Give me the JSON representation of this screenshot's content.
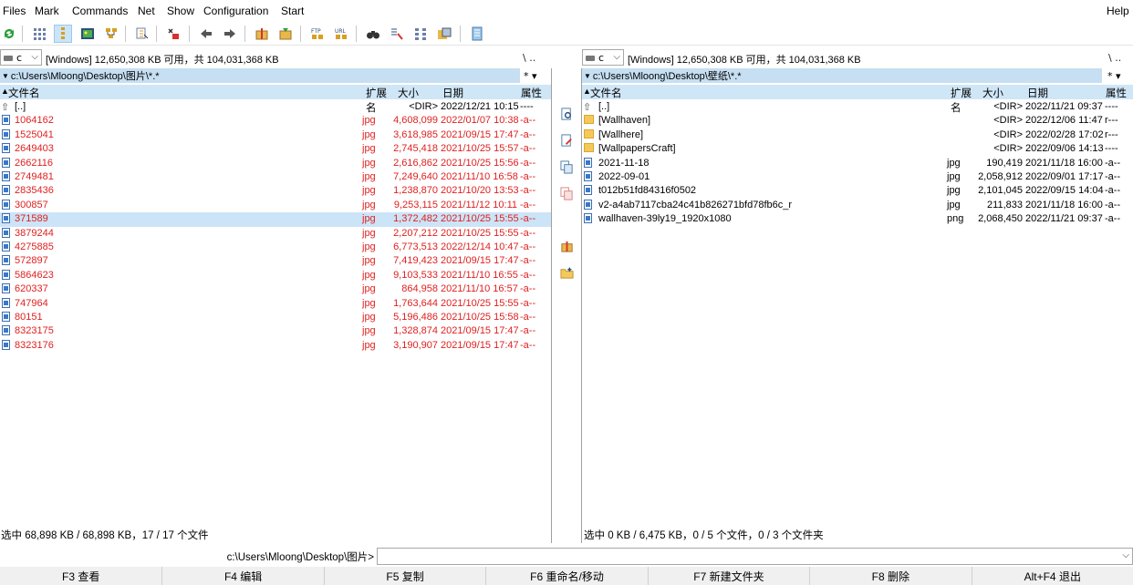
{
  "menu": {
    "files": "Files",
    "mark": "Mark",
    "commands": "Commands",
    "net": "Net",
    "show": "Show",
    "configuration": "Configuration",
    "start": "Start",
    "help": "Help"
  },
  "toolbar": {
    "icons": [
      "refresh-icon",
      "brief-view-icon",
      "full-view-icon",
      "thumbnail-icon",
      "tree-icon",
      "invert-selection-icon",
      "unpack-icon",
      "back-icon",
      "forward-icon",
      "pack-icon",
      "unpack-files-icon",
      "ftp-icon",
      "url-icon",
      "search-icon",
      "multi-rename-icon",
      "sync-dirs-icon",
      "compare-icon",
      "notepad-icon"
    ]
  },
  "left": {
    "drive": "c",
    "drive_info": "[Windows]  12,650,308 KB 可用，共 104,031,368 KB",
    "root_btns": "\\   ..",
    "path": "c:\\Users\\Mloong\\Desktop\\图片\\*.*",
    "path_tools": "*  ▾",
    "columns": {
      "name": "文件名",
      "ext": "扩展名",
      "size": "大小",
      "date": "日期",
      "attr": "属性"
    },
    "up": {
      "name": "[..]",
      "size": "<DIR>",
      "date": "2022/12/21 10:15",
      "attr": "----"
    },
    "files": [
      {
        "name": "1064162",
        "ext": "jpg",
        "size": "4,608,099",
        "date": "2022/01/07 10:38",
        "attr": "-a--"
      },
      {
        "name": "1525041",
        "ext": "jpg",
        "size": "3,618,985",
        "date": "2021/09/15 17:47",
        "attr": "-a--"
      },
      {
        "name": "2649403",
        "ext": "jpg",
        "size": "2,745,418",
        "date": "2021/10/25 15:57",
        "attr": "-a--"
      },
      {
        "name": "2662116",
        "ext": "jpg",
        "size": "2,616,862",
        "date": "2021/10/25 15:56",
        "attr": "-a--"
      },
      {
        "name": "2749481",
        "ext": "jpg",
        "size": "7,249,640",
        "date": "2021/11/10 16:58",
        "attr": "-a--"
      },
      {
        "name": "2835436",
        "ext": "jpg",
        "size": "1,238,870",
        "date": "2021/10/20 13:53",
        "attr": "-a--"
      },
      {
        "name": "300857",
        "ext": "jpg",
        "size": "9,253,115",
        "date": "2021/11/12 10:11",
        "attr": "-a--"
      },
      {
        "name": "371589",
        "ext": "jpg",
        "size": "1,372,482",
        "date": "2021/10/25 15:55",
        "attr": "-a--"
      },
      {
        "name": "3879244",
        "ext": "jpg",
        "size": "2,207,212",
        "date": "2021/10/25 15:55",
        "attr": "-a--"
      },
      {
        "name": "4275885",
        "ext": "jpg",
        "size": "6,773,513",
        "date": "2022/12/14 10:47",
        "attr": "-a--"
      },
      {
        "name": "572897",
        "ext": "jpg",
        "size": "7,419,423",
        "date": "2021/09/15 17:47",
        "attr": "-a--"
      },
      {
        "name": "5864623",
        "ext": "jpg",
        "size": "9,103,533",
        "date": "2021/11/10 16:55",
        "attr": "-a--"
      },
      {
        "name": "620337",
        "ext": "jpg",
        "size": "864,958",
        "date": "2021/11/10 16:57",
        "attr": "-a--"
      },
      {
        "name": "747964",
        "ext": "jpg",
        "size": "1,763,644",
        "date": "2021/10/25 15:55",
        "attr": "-a--"
      },
      {
        "name": "80151",
        "ext": "jpg",
        "size": "5,196,486",
        "date": "2021/10/25 15:58",
        "attr": "-a--"
      },
      {
        "name": "8323175",
        "ext": "jpg",
        "size": "1,328,874",
        "date": "2021/09/15 17:47",
        "attr": "-a--"
      },
      {
        "name": "8323176",
        "ext": "jpg",
        "size": "3,190,907",
        "date": "2021/09/15 17:47",
        "attr": "-a--"
      }
    ],
    "status": "选中 68,898 KB / 68,898 KB，17 / 17 个文件"
  },
  "right": {
    "drive": "c",
    "drive_info": "[Windows]  12,650,308 KB 可用，共 104,031,368 KB",
    "root_btns": "\\   ..",
    "path": "c:\\Users\\Mloong\\Desktop\\壁纸\\*.*",
    "path_tools": "*  ▾",
    "columns": {
      "name": "文件名",
      "ext": "扩展名",
      "size": "大小",
      "date": "日期",
      "attr": "属性"
    },
    "up": {
      "name": "[..]",
      "size": "<DIR>",
      "date": "2022/11/21 09:37",
      "attr": "----"
    },
    "dirs": [
      {
        "name": "[Wallhaven]",
        "size": "<DIR>",
        "date": "2022/12/06 11:47",
        "attr": "r---"
      },
      {
        "name": "[Wallhere]",
        "size": "<DIR>",
        "date": "2022/02/28 17:02",
        "attr": "r---"
      },
      {
        "name": "[WallpapersCraft]",
        "size": "<DIR>",
        "date": "2022/09/06 14:13",
        "attr": "----"
      }
    ],
    "files": [
      {
        "name": "2021-11-18",
        "ext": "jpg",
        "size": "190,419",
        "date": "2021/11/18 16:00",
        "attr": "-a--"
      },
      {
        "name": "2022-09-01",
        "ext": "jpg",
        "size": "2,058,912",
        "date": "2022/09/01 17:17",
        "attr": "-a--"
      },
      {
        "name": "t012b51fd84316f0502",
        "ext": "jpg",
        "size": "2,101,045",
        "date": "2022/09/15 14:04",
        "attr": "-a--"
      },
      {
        "name": "v2-a4ab7117cba24c41b826271bfd78fb6c_r",
        "ext": "jpg",
        "size": "211,833",
        "date": "2021/11/18 16:00",
        "attr": "-a--"
      },
      {
        "name": "wallhaven-39ly19_1920x1080",
        "ext": "png",
        "size": "2,068,450",
        "date": "2022/11/21 09:37",
        "attr": "-a--"
      }
    ],
    "status": "选中 0 KB / 6,475 KB，0 / 5 个文件，0 / 3 个文件夹"
  },
  "cmdline": {
    "label": "c:\\Users\\Mloong\\Desktop\\图片>",
    "value": ""
  },
  "fkeys": [
    "F3 查看",
    "F4 编辑",
    "F5 复制",
    "F6 重命名/移动",
    "F7 新建文件夹",
    "F8 删除",
    "Alt+F4 退出"
  ],
  "colors": {
    "selection": "#cce4f7",
    "path_bar": "#c6dff2",
    "header": "#cfe6f7",
    "marked_text": "#e02020"
  }
}
